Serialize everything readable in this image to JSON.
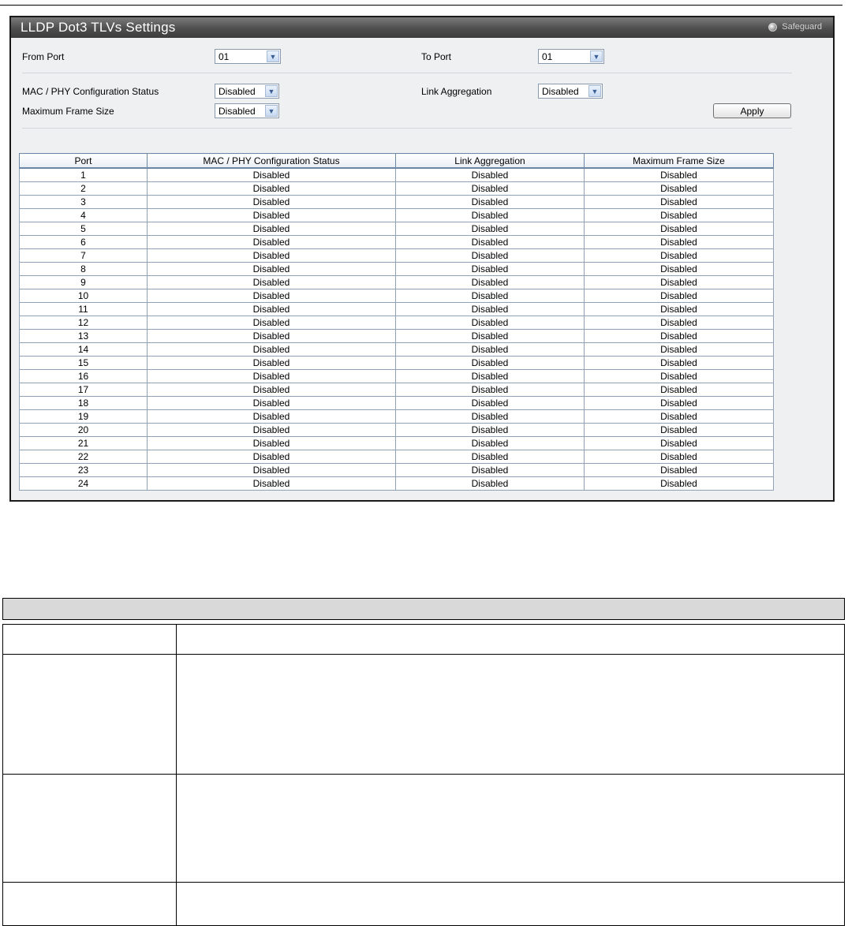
{
  "panel": {
    "title": "LLDP Dot3 TLVs Settings",
    "safeguard_label": "Safeguard"
  },
  "form": {
    "from_port": {
      "label": "From Port",
      "value": "01"
    },
    "to_port": {
      "label": "To Port",
      "value": "01"
    },
    "mac_phy": {
      "label": "MAC / PHY Configuration Status",
      "value": "Disabled"
    },
    "link_agg": {
      "label": "Link Aggregation",
      "value": "Disabled"
    },
    "max_frame": {
      "label": "Maximum Frame Size",
      "value": "Disabled"
    },
    "apply_label": "Apply"
  },
  "table": {
    "headers": [
      "Port",
      "MAC / PHY Configuration Status",
      "Link Aggregation",
      "Maximum Frame Size"
    ],
    "rows": [
      [
        "1",
        "Disabled",
        "Disabled",
        "Disabled"
      ],
      [
        "2",
        "Disabled",
        "Disabled",
        "Disabled"
      ],
      [
        "3",
        "Disabled",
        "Disabled",
        "Disabled"
      ],
      [
        "4",
        "Disabled",
        "Disabled",
        "Disabled"
      ],
      [
        "5",
        "Disabled",
        "Disabled",
        "Disabled"
      ],
      [
        "6",
        "Disabled",
        "Disabled",
        "Disabled"
      ],
      [
        "7",
        "Disabled",
        "Disabled",
        "Disabled"
      ],
      [
        "8",
        "Disabled",
        "Disabled",
        "Disabled"
      ],
      [
        "9",
        "Disabled",
        "Disabled",
        "Disabled"
      ],
      [
        "10",
        "Disabled",
        "Disabled",
        "Disabled"
      ],
      [
        "11",
        "Disabled",
        "Disabled",
        "Disabled"
      ],
      [
        "12",
        "Disabled",
        "Disabled",
        "Disabled"
      ],
      [
        "13",
        "Disabled",
        "Disabled",
        "Disabled"
      ],
      [
        "14",
        "Disabled",
        "Disabled",
        "Disabled"
      ],
      [
        "15",
        "Disabled",
        "Disabled",
        "Disabled"
      ],
      [
        "16",
        "Disabled",
        "Disabled",
        "Disabled"
      ],
      [
        "17",
        "Disabled",
        "Disabled",
        "Disabled"
      ],
      [
        "18",
        "Disabled",
        "Disabled",
        "Disabled"
      ],
      [
        "19",
        "Disabled",
        "Disabled",
        "Disabled"
      ],
      [
        "20",
        "Disabled",
        "Disabled",
        "Disabled"
      ],
      [
        "21",
        "Disabled",
        "Disabled",
        "Disabled"
      ],
      [
        "22",
        "Disabled",
        "Disabled",
        "Disabled"
      ],
      [
        "23",
        "Disabled",
        "Disabled",
        "Disabled"
      ],
      [
        "24",
        "Disabled",
        "Disabled",
        "Disabled"
      ]
    ]
  },
  "colors": {
    "title_bar": "#4e4e4e",
    "panel_bg": "#eef0f2",
    "doc_header_bg": "#d9d9d9"
  },
  "icons": {
    "dropdown": "chevron-down-icon",
    "safeguard": "status-dot-icon"
  }
}
